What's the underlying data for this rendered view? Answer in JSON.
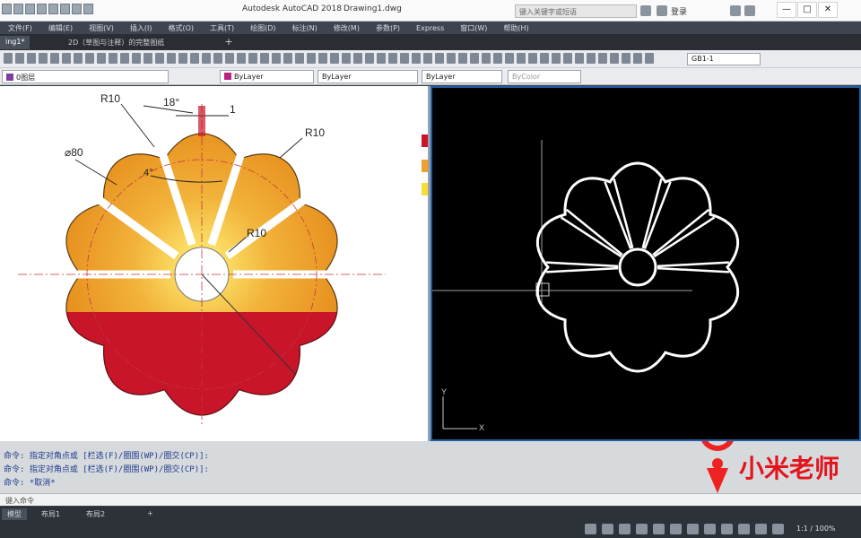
{
  "window": {
    "app_title": "Autodesk AutoCAD 2018",
    "file_title": "Drawing1.dwg",
    "search_placeholder": "键入关键字或短语",
    "user_label": "登录",
    "minimize": "—",
    "maximize": "□",
    "close": "✕"
  },
  "menubar": {
    "items": [
      "文件(F)",
      "编辑(E)",
      "视图(V)",
      "插入(I)",
      "格式(O)",
      "工具(T)",
      "绘图(D)",
      "标注(N)",
      "修改(M)",
      "参数(P)",
      "Express",
      "窗口(W)",
      "帮助(H)"
    ]
  },
  "doc_tabs": {
    "items": [
      "ing1*",
      "2D（草图与注释）的完整图纸"
    ]
  },
  "toolbar": {
    "layer_value": "0图层",
    "color_value": "ByLayer",
    "linetype_value": "ByLayer",
    "lineweight_value": "ByLayer",
    "plotstyle_value": "ByColor",
    "dimstyle_value": "GB1-1",
    "colors": {
      "layer_swatch": "#7a3fa0",
      "color_swatch": "#c02080"
    }
  },
  "reference_drawing": {
    "dimensions": {
      "r10_top": "R10",
      "angle_18": "18°",
      "gap_1": "1",
      "r10_right": "R10",
      "dia_80": "⌀80",
      "angle_4": "4°",
      "r10_inner": "R10"
    },
    "colors": {
      "top_gradient_inner": "#fff27a",
      "top_gradient_mid": "#f2b33a",
      "top_gradient_outer": "#e58a1a",
      "bottom_fill": "#c8152a",
      "center_line": "#d43a3a"
    }
  },
  "side_color_strip": {
    "colors": [
      "#c8152a",
      "#f0a030",
      "#f6dd3a"
    ]
  },
  "model_view": {
    "ucs_y": "Y",
    "ucs_x": "X",
    "background": "#000000",
    "geometry_color": "#ffffff"
  },
  "command_history": [
    "命令: 指定对角点或 [栏选(F)/圈围(WP)/圈交(CP)]:",
    "命令: 指定对角点或 [栏选(F)/圈围(WP)/圈交(CP)]:",
    "命令: *取消*"
  ],
  "command_input_placeholder": "键入命令",
  "watermark_text": "小米老师",
  "layout_tabs": [
    "模型",
    "布局1",
    "布局2"
  ],
  "status": {
    "zoom": "1:1 / 100%"
  }
}
